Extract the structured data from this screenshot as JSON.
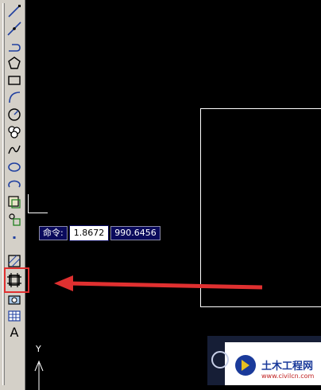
{
  "toolbar": {
    "tools": [
      {
        "icon": "line-icon"
      },
      {
        "icon": "construction-line-icon"
      },
      {
        "icon": "polyline-icon"
      },
      {
        "icon": "polygon-icon"
      },
      {
        "icon": "rectangle-icon"
      },
      {
        "icon": "arc-icon"
      },
      {
        "icon": "circle-icon"
      },
      {
        "icon": "revision-cloud-icon"
      },
      {
        "icon": "spline-icon"
      },
      {
        "icon": "ellipse-icon"
      },
      {
        "icon": "ellipse-arc-icon"
      },
      {
        "icon": "insert-block-icon"
      },
      {
        "icon": "make-block-icon"
      },
      {
        "icon": "point-icon"
      },
      {
        "icon": "hatch-icon"
      },
      {
        "icon": "gradient-icon"
      },
      {
        "icon": "region-icon"
      },
      {
        "icon": "table-icon"
      },
      {
        "icon": "multiline-text-icon",
        "glyph": "A"
      }
    ]
  },
  "command_tooltip": {
    "label": "命令:",
    "value": "1.8672",
    "value2": "990.6456"
  },
  "ucs": {
    "y_label": "Y"
  },
  "watermark": {
    "brand": "土木工程网",
    "url": "www.civilcn.com"
  },
  "colors": {
    "annotation_red": "#e03030",
    "tooltip_bg": "#0a0a5c",
    "watermark_accent": "#1a3a9a"
  }
}
